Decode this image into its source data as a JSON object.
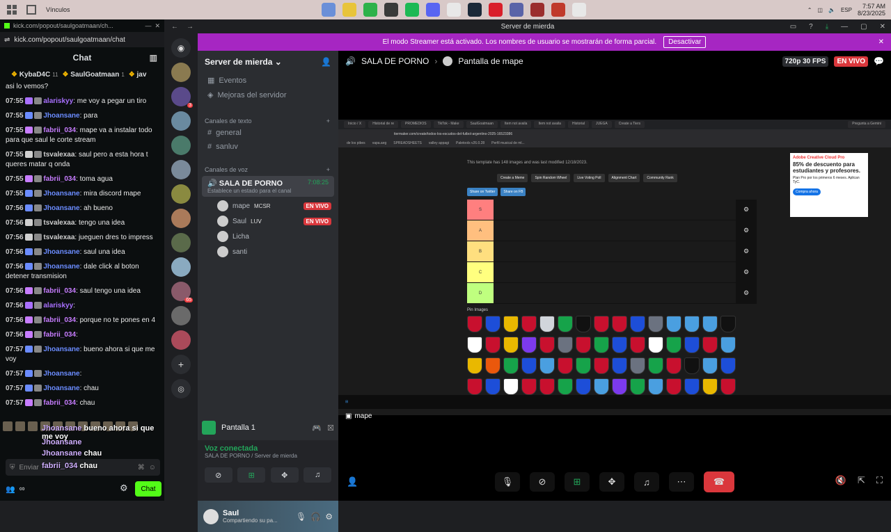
{
  "taskbar": {
    "left_label": "Vínculos",
    "lang": "ESP",
    "time": "7:57 AM",
    "date": "8/23/2025",
    "app_colors": [
      "#6a8fd8",
      "#e8c43a",
      "#2db24a",
      "#3a3a3a",
      "#1db954",
      "#5865f2",
      "#e8e8e8",
      "#1b2838",
      "#d91e2a",
      "#5a63a8",
      "#9b2d2d",
      "#c0392b",
      "#e8e8e8"
    ]
  },
  "kick": {
    "tab_url": "kick.com/popout/saulgoatmaan/ch...",
    "url": "kick.com/popout/saulgoatmaan/chat",
    "chat_title": "Chat",
    "pinned": [
      {
        "name": "KybaD4C",
        "count": "11"
      },
      {
        "name": "SaulGoatmaan",
        "count": "1"
      },
      {
        "name": "jav",
        "count": ""
      }
    ],
    "messages": [
      {
        "time": "",
        "user": "",
        "user_color": "#ffffff",
        "text": "asi lo vemos?"
      },
      {
        "time": "07:55",
        "user": "alariskyy",
        "user_color": "#a970ff",
        "text": ": me voy a pegar un tiro"
      },
      {
        "time": "07:55",
        "user": "Jhoansane",
        "user_color": "#6b8cff",
        "text": ": para"
      },
      {
        "time": "07:55",
        "user": "fabrii_034",
        "user_color": "#c77dff",
        "text": ": mape va a instalar todo para que saul le corte stream"
      },
      {
        "time": "07:55",
        "user": "tsvalexaa",
        "user_color": "#d0d0d0",
        "text": ": saul pero a esta hora t queres matar q onda"
      },
      {
        "time": "07:55",
        "user": "fabrii_034",
        "user_color": "#c77dff",
        "text": ": toma agua"
      },
      {
        "time": "07:55",
        "user": "Jhoansane",
        "user_color": "#6b8cff",
        "text": ": mira discord mape"
      },
      {
        "time": "07:56",
        "user": "Jhoansane",
        "user_color": "#6b8cff",
        "text": ": ah bueno"
      },
      {
        "time": "07:56",
        "user": "tsvalexaa",
        "user_color": "#d0d0d0",
        "text": ": tengo una idea"
      },
      {
        "time": "07:56",
        "user": "tsvalexaa",
        "user_color": "#d0d0d0",
        "text": ": jueguen dres to impress"
      },
      {
        "time": "07:56",
        "user": "Jhoansane",
        "user_color": "#6b8cff",
        "text": ": saul una idea"
      },
      {
        "time": "07:56",
        "user": "Jhoansane",
        "user_color": "#6b8cff",
        "text": ": dale click al boton detener transmision"
      },
      {
        "time": "07:56",
        "user": "fabrii_034",
        "user_color": "#c77dff",
        "text": ": saul tengo una idea"
      },
      {
        "time": "07:56",
        "user": "alariskyy",
        "user_color": "#a970ff",
        "text": ":"
      },
      {
        "time": "07:56",
        "user": "fabrii_034",
        "user_color": "#c77dff",
        "text": ": porque no te pones en 4"
      },
      {
        "time": "07:56",
        "user": "fabrii_034",
        "user_color": "#c77dff",
        "text": ":"
      },
      {
        "time": "07:57",
        "user": "Jhoansane",
        "user_color": "#6b8cff",
        "text": ": bueno ahora si que me voy"
      },
      {
        "time": "07:57",
        "user": "Jhoansane",
        "user_color": "#6b8cff",
        "text": ":"
      },
      {
        "time": "07:57",
        "user": "Jhoansane",
        "user_color": "#6b8cff",
        "text": ": chau"
      },
      {
        "time": "07:57",
        "user": "fabrii_034",
        "user_color": "#c77dff",
        "text": ": chau"
      }
    ],
    "overlay": [
      {
        "user": "Jhoansane",
        "text": "bueno ahora si que me voy"
      },
      {
        "user": "Jhoansane",
        "text": ""
      },
      {
        "user": "Jhoansane",
        "text": "chau"
      },
      {
        "user": "fabrii_034",
        "text": "chau"
      }
    ],
    "input_placeholder": "Enviar",
    "chat_button": "Chat"
  },
  "discord": {
    "window_title": "Server de mierda",
    "banner_text": "El modo Streamer está activado. Los nombres de usuario se mostrarán de forma parcial.",
    "banner_button": "Desactivar",
    "server_name": "Server de mierda",
    "top_items": [
      "Eventos",
      "Mejoras del servidor"
    ],
    "text_category": "Canales de texto",
    "text_channels": [
      "general",
      "sanluv"
    ],
    "voice_category": "Canales de voz",
    "voice_channel": "SALA DE PORNO",
    "voice_time": "7:08:25",
    "voice_status": "Establece un estado para el canal",
    "voice_users": [
      {
        "name": "mape",
        "tag": "MCSR",
        "live": "EN VIVO"
      },
      {
        "name": "Saul",
        "tag": "ᒪᑌᐯ",
        "live": "EN VIVO"
      },
      {
        "name": "Licha",
        "tag": "",
        "live": ""
      },
      {
        "name": "santi",
        "tag": "",
        "live": ""
      }
    ],
    "guild_badges": [
      "3",
      "65"
    ],
    "pantalla": "Pantalla 1",
    "voice_connected": "Voz conectada",
    "voice_location": "SALA DE PORNO / Server de mierda",
    "user_name": "Saul",
    "user_status": "Compartiendo su pa...",
    "stage": {
      "channel": "SALA DE PORNO",
      "stream_title": "Pantalla de mape",
      "quality": "720p 30 FPS",
      "live": "EN VIVO",
      "screen_owner": "mape"
    }
  },
  "shared_screen": {
    "tabs": [
      "Inicio / X",
      "Historial de re",
      "PROMEDIOS",
      "TikTok - Make",
      "SaulGoatmaan",
      "Item not availa",
      "Item not availa",
      "Historial",
      "JUEGA",
      "Create a Tiers"
    ],
    "url": "tiermaker.com/create/todos-los-escudos-del-futbol-argentino-2025-16523386",
    "bookmarks": [
      "de los pibes",
      "vapa.aeg",
      "SPREADSHEETS",
      "valley appagi",
      "Paletools v26.0.28",
      "Perfil musical de ml..."
    ],
    "info": "This template has 148 images and was last modified 12/18/2023.",
    "buttons": [
      "Create a Meme",
      "Spin Random Wheel",
      "Live Voting Poll",
      "Alignment Chart",
      "Community Rank"
    ],
    "share": [
      "Share on Twitter",
      "Share on FB"
    ],
    "tiers": [
      {
        "label": "S",
        "color": "#ff7f7f"
      },
      {
        "label": "A",
        "color": "#ffbf7f"
      },
      {
        "label": "B",
        "color": "#ffdf7f"
      },
      {
        "label": "C",
        "color": "#ffff7f"
      },
      {
        "label": "D",
        "color": "#bfff7f"
      }
    ],
    "pin_label": "Pin Images",
    "crest_colors": [
      "#c8102e",
      "#1d4ed8",
      "#e9b800",
      "#c8102e",
      "#d1d5db",
      "#16a34a",
      "#111111",
      "#c8102e",
      "#c8102e",
      "#1d4ed8",
      "#6b7280",
      "#4a9fe0",
      "#4a9fe0",
      "#4a9fe0",
      "#111111",
      "#ffffff",
      "#c8102e",
      "#e9b800",
      "#7c3aed",
      "#c8102e",
      "#6b7280",
      "#c8102e",
      "#16a34a",
      "#1d4ed8",
      "#c8102e",
      "#ffffff",
      "#16a34a",
      "#1d4ed8",
      "#c8102e",
      "#4a9fe0",
      "#e9b800",
      "#ea580c",
      "#16a34a",
      "#1d4ed8",
      "#4a9fe0",
      "#c8102e",
      "#16a34a",
      "#c8102e",
      "#1d4ed8",
      "#6b7280",
      "#16a34a",
      "#c8102e",
      "#111111",
      "#4a9fe0",
      "#1d4ed8",
      "#c8102e",
      "#1d4ed8",
      "#ffffff",
      "#c8102e",
      "#c8102e",
      "#16a34a",
      "#1d4ed8",
      "#4a9fe0",
      "#7c3aed",
      "#16a34a",
      "#4a9fe0",
      "#c8102e",
      "#1d4ed8",
      "#e9b800",
      "#c8102e"
    ],
    "ad": {
      "brand": "Adobe Creative Cloud Pro",
      "headline": "85% de descuento para estudiantes y profesores.",
      "sub": "Plan Pro por los primeros 6 meses. Aplican TyC.",
      "cta": "Compra ahora"
    },
    "tab_right": "Pregunta a Gemini"
  },
  "colors": {
    "discord_bg": "#1e1f22",
    "banner": "#a626c2",
    "kick_green": "#53fc18",
    "live_red": "#da373c"
  }
}
